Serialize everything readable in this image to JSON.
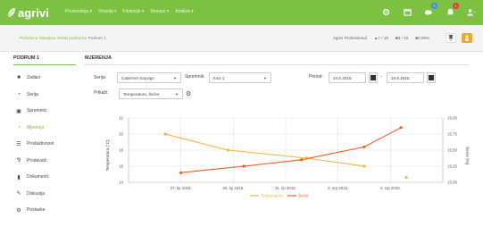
{
  "app": {
    "logo_text": "agrivi"
  },
  "nav": [
    {
      "label": "Proizvodnja ▾"
    },
    {
      "label": "Vinarija ▾"
    },
    {
      "label": "Financije ▾"
    },
    {
      "label": "Resursi ▾"
    },
    {
      "label": "Analiza ▾"
    }
  ],
  "top_icons": {
    "settings": "gear-icon",
    "calendar": "calendar-icon",
    "weather": "weather-icon",
    "weather_badge": "2",
    "notifications": "bell-icon",
    "notifications_badge": "1",
    "user": "user-icon"
  },
  "breadcrumb": {
    "items": [
      "Početna",
      "Vinarija",
      "Vinski podrumi",
      "Podrum 1"
    ],
    "separator": " ▸ "
  },
  "plan": {
    "name": "Agrivi Professional",
    "users": "7 / 10",
    "parcels": "3 / 10",
    "storage": "0.09%"
  },
  "sidebar": {
    "title": "PODRUM 1",
    "items": [
      {
        "label": "Zadaci",
        "icon": "tasks-icon",
        "active": false
      },
      {
        "label": "Serija",
        "icon": "series-icon",
        "active": false
      },
      {
        "label": "Spremnici",
        "icon": "tank-icon",
        "active": false
      },
      {
        "label": "Mjerenja",
        "icon": "measurement-icon",
        "active": true
      },
      {
        "label": "Produktivnost",
        "icon": "productivity-icon",
        "active": false
      },
      {
        "label": "Prodavači",
        "icon": "sellers-icon",
        "active": false
      },
      {
        "label": "Dokumenti",
        "icon": "documents-icon",
        "active": false
      },
      {
        "label": "Diskusija",
        "icon": "discussion-icon",
        "active": false
      },
      {
        "label": "Postavke",
        "icon": "settings-icon",
        "active": false
      }
    ]
  },
  "main": {
    "title": "MJERENJA",
    "filters": {
      "serija_label": "Serija:",
      "serija_value": "Cabernet Sauvign",
      "spremnik_label": "Spremnik:",
      "spremnik_value": "Inox 1",
      "period_label": "Period:",
      "date_from": "24.6.2015.",
      "date_sep": "-",
      "date_to": "18.8.2015.",
      "prikazi_label": "Prikaži:",
      "prikazi_value": "Temperatura, Šećer"
    }
  },
  "chart_data": {
    "type": "line",
    "x_ticks": [
      "27. lip 2015.",
      "20. lip 2015.",
      "31. lip 2015.",
      "2. srp 2015.",
      "4. srp 2015."
    ],
    "y_left": {
      "label": "Temperatura [°C]",
      "ticks": [
        "22",
        "20",
        "18",
        "16",
        "14"
      ],
      "lim": [
        14,
        22
      ]
    },
    "y_right": {
      "label": "Šećer [%]",
      "ticks": [
        "16,00",
        "15,75",
        "15,50",
        "15,25",
        "15,00"
      ],
      "lim": [
        15.0,
        16.0
      ]
    },
    "series": [
      {
        "name": "Temperatura",
        "axis": "left",
        "color": "#f5b240",
        "points": [
          [
            0.7,
            20.0
          ],
          [
            1.9,
            18.0
          ],
          [
            3.4,
            17.0
          ],
          [
            4.5,
            16.0
          ]
        ],
        "isolated": [
          [
            5.3,
            14.6
          ]
        ]
      },
      {
        "name": "Šećer",
        "axis": "right",
        "color": "#f05a22",
        "points": [
          [
            1.0,
            15.15
          ],
          [
            2.2,
            15.25
          ],
          [
            3.3,
            15.35
          ],
          [
            4.5,
            15.55
          ],
          [
            5.2,
            15.85
          ]
        ]
      }
    ],
    "grid": true,
    "legend": "bottom-center"
  }
}
